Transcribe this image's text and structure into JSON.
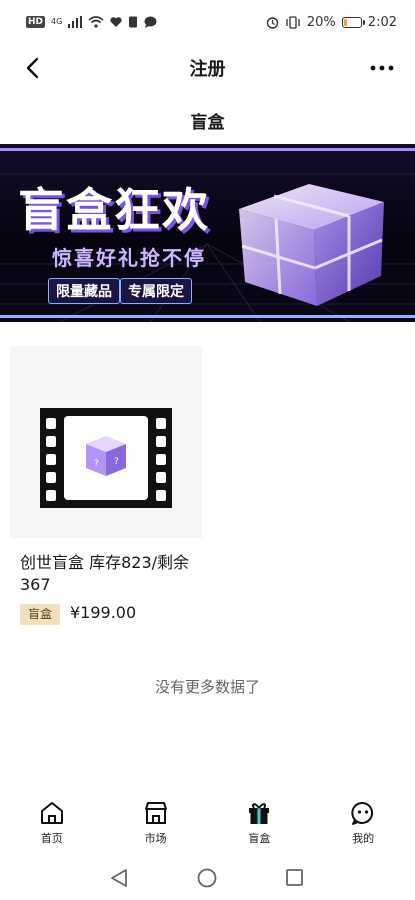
{
  "status_bar": {
    "signal_badge": "HD",
    "network": "4G",
    "battery_percent": "20%",
    "battery_level": 0.2,
    "time": "2:02"
  },
  "nav": {
    "title": "注册"
  },
  "section_title": "盲盒",
  "banner": {
    "headline": "盲盒狂欢",
    "subtitle": "惊喜好礼抢不停",
    "tags": [
      "限量藏品",
      "专属限定"
    ]
  },
  "product": {
    "name": "创世盲盒 库存823/剩余367",
    "tag": "盲盒",
    "price": "¥199.00"
  },
  "no_more_text": "没有更多数据了",
  "tab_bar": {
    "tabs": [
      {
        "label": "首页",
        "icon": "home-icon"
      },
      {
        "label": "市场",
        "icon": "store-icon"
      },
      {
        "label": "盲盒",
        "icon": "gift-icon"
      },
      {
        "label": "我的",
        "icon": "profile-icon"
      }
    ]
  },
  "colors": {
    "tag_bg": "#f2dfc0",
    "banner_accent": "#7a52e6"
  }
}
